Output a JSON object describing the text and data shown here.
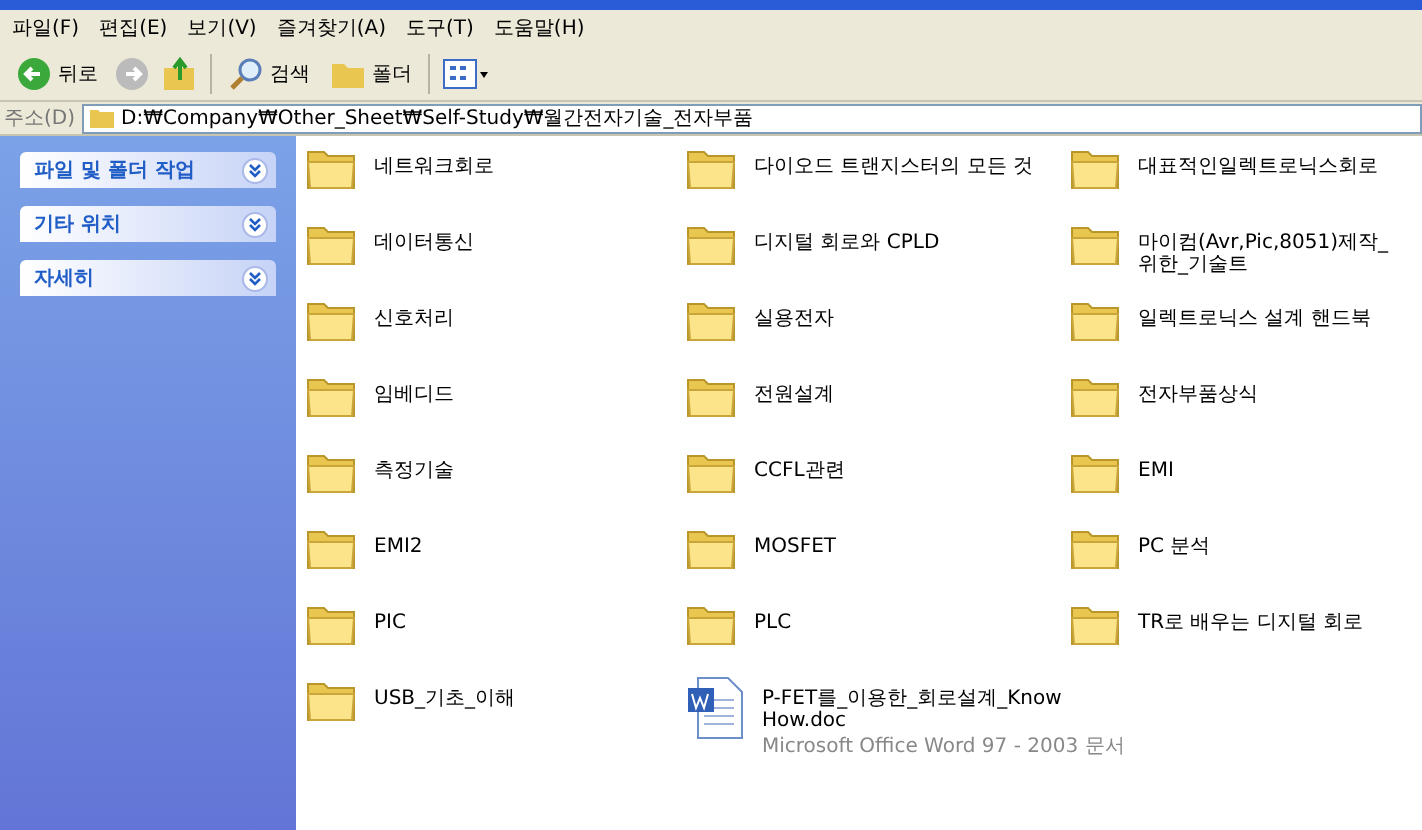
{
  "menu": [
    "파일(F)",
    "편집(E)",
    "보기(V)",
    "즐겨찾기(A)",
    "도구(T)",
    "도움말(H)"
  ],
  "toolbar": {
    "back": "뒤로",
    "search": "검색",
    "folders": "폴더"
  },
  "address": {
    "label": "주소(D)",
    "path": "D:₩Company₩Other_Sheet₩Self-Study₩월간전자기술_전자부품"
  },
  "sidebar": {
    "panels": [
      {
        "title": "파일 및 폴더 작업",
        "expanded": false
      },
      {
        "title": "기타 위치",
        "expanded": false
      },
      {
        "title": "자세히",
        "expanded": false
      }
    ]
  },
  "items": [
    {
      "kind": "folder",
      "name": "네트워크회로"
    },
    {
      "kind": "folder",
      "name": "다이오드 트랜지스터의 모든 것"
    },
    {
      "kind": "folder",
      "name": "대표적인일렉트로닉스회로"
    },
    {
      "kind": "folder",
      "name": "데이터통신"
    },
    {
      "kind": "folder",
      "name": "디지털 회로와 CPLD"
    },
    {
      "kind": "folder",
      "name": "마이컴(Avr,Pic,8051)제작_위한_기술트"
    },
    {
      "kind": "folder",
      "name": "신호처리"
    },
    {
      "kind": "folder",
      "name": "실용전자"
    },
    {
      "kind": "folder",
      "name": "일렉트로닉스 설계 핸드북"
    },
    {
      "kind": "folder",
      "name": "임베디드"
    },
    {
      "kind": "folder",
      "name": "전원설계"
    },
    {
      "kind": "folder",
      "name": "전자부품상식"
    },
    {
      "kind": "folder",
      "name": "측정기술"
    },
    {
      "kind": "folder",
      "name": "CCFL관련"
    },
    {
      "kind": "folder",
      "name": "EMI"
    },
    {
      "kind": "folder",
      "name": "EMI2"
    },
    {
      "kind": "folder",
      "name": "MOSFET"
    },
    {
      "kind": "folder",
      "name": "PC 분석"
    },
    {
      "kind": "folder",
      "name": "PIC"
    },
    {
      "kind": "folder",
      "name": "PLC"
    },
    {
      "kind": "folder",
      "name": "TR로 배우는 디지털 회로"
    },
    {
      "kind": "folder",
      "name": "USB_기초_이해"
    },
    {
      "kind": "document",
      "name": "P-FET를_이용한_회로설계_KnowHow.doc",
      "type": "Microsoft Office Word 97 - 2003 문서"
    }
  ]
}
